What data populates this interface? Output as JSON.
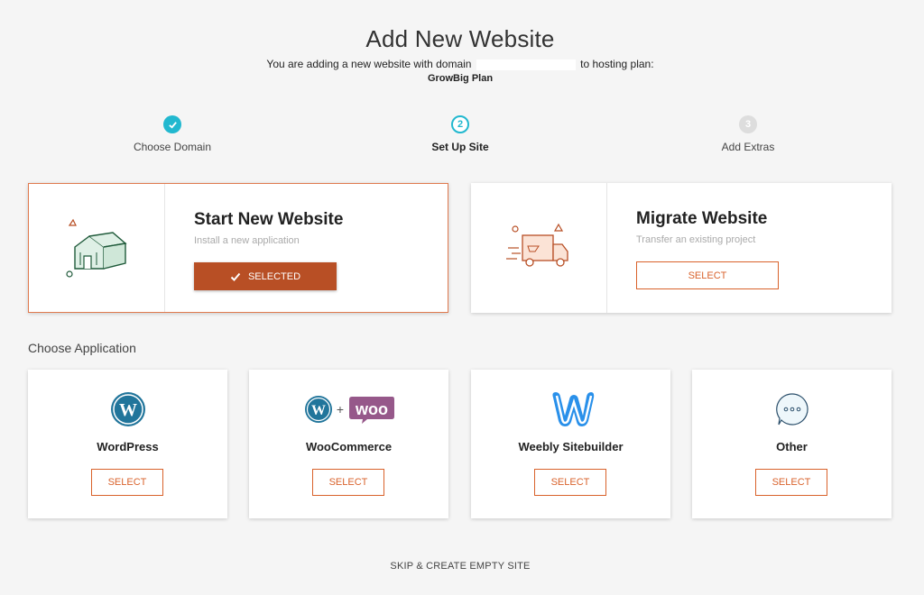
{
  "page": {
    "title": "Add New Website",
    "subtitle_before": "You are adding a new website with domain",
    "subtitle_after": "to hosting plan:",
    "plan_name": "GrowBig Plan"
  },
  "steps": [
    {
      "label": "Choose Domain",
      "number": "1",
      "status": "done"
    },
    {
      "label": "Set Up Site",
      "number": "2",
      "status": "current"
    },
    {
      "label": "Add Extras",
      "number": "3",
      "status": "pending"
    }
  ],
  "options": {
    "start": {
      "title": "Start New Website",
      "desc": "Install a new application",
      "button": "SELECTED",
      "icon": "house-icon"
    },
    "migrate": {
      "title": "Migrate Website",
      "desc": "Transfer an existing project",
      "button": "SELECT",
      "icon": "truck-icon"
    }
  },
  "apps": {
    "section_label": "Choose Application",
    "items": [
      {
        "name": "WordPress",
        "button": "SELECT",
        "icon": "wordpress-icon"
      },
      {
        "name": "WooCommerce",
        "button": "SELECT",
        "icon": "woocommerce-icon"
      },
      {
        "name": "Weebly Sitebuilder",
        "button": "SELECT",
        "icon": "weebly-icon"
      },
      {
        "name": "Other",
        "button": "SELECT",
        "icon": "chat-bubble-icon"
      }
    ]
  },
  "footer": {
    "skip_label": "SKIP & CREATE EMPTY SITE"
  },
  "colors": {
    "accent": "#d9622b",
    "selected_button": "#b84f25",
    "step_active": "#22b8cf",
    "wordpress_blue": "#21759b",
    "woo_purple": "#96588a",
    "weebly_blue": "#2990ea"
  }
}
